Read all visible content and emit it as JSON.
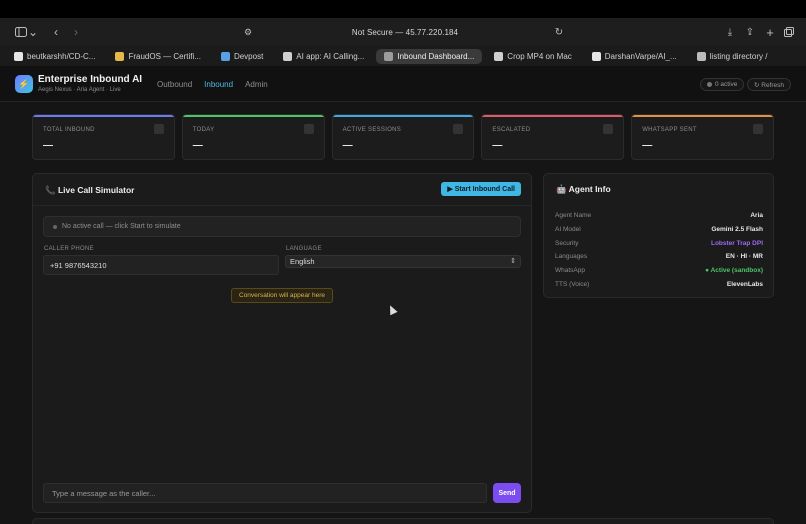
{
  "browser": {
    "address": "Not Secure — 45.77.220.184",
    "tabs": [
      {
        "label": "beutkarshh/CD-C...",
        "color": "#e5e5e5"
      },
      {
        "label": "FraudOS — Certifi...",
        "color": "#e6b84a"
      },
      {
        "label": "Devpost",
        "color": "#5aa0e6"
      },
      {
        "label": "AI app: AI Calling...",
        "color": "#cfcfcf"
      },
      {
        "label": "Inbound Dashboard...",
        "color": "#9c9c9c",
        "active": true
      },
      {
        "label": "Crop MP4 on Mac",
        "color": "#cfcfcf"
      },
      {
        "label": "DarshanVarpe/AI_...",
        "color": "#e5e5e5"
      },
      {
        "label": "listing directory /",
        "color": "#bbbbbb"
      }
    ]
  },
  "app": {
    "title": "Enterprise Inbound AI",
    "subtitle": "Aegis Nexus · Aria Agent · Live",
    "nav": [
      "Outbound",
      "Inbound",
      "Admin"
    ],
    "active_nav": "Inbound",
    "active_pill": "0 active",
    "refresh_label": "↻ Refresh"
  },
  "stats": [
    {
      "label": "TOTAL INBOUND",
      "value": "—",
      "color": "#6b7cf0",
      "icon": "phone-icon"
    },
    {
      "label": "TODAY",
      "value": "—",
      "color": "#4cc46a",
      "icon": "calendar-icon"
    },
    {
      "label": "ACTIVE SESSIONS",
      "value": "—",
      "color": "#3fa8e0",
      "icon": "robot-icon"
    },
    {
      "label": "ESCALATED",
      "value": "—",
      "color": "#e05a6a",
      "icon": "alert-icon"
    },
    {
      "label": "WHATSAPP SENT",
      "value": "—",
      "color": "#e0904a",
      "icon": "chat-icon"
    }
  ],
  "simulator": {
    "title": "📞 Live Call Simulator",
    "start_label": "▶ Start Inbound Call",
    "status": "No active call — click Start to simulate",
    "caller_phone_label": "CALLER PHONE",
    "caller_phone_value": "+91 9876543210",
    "language_label": "LANGUAGE",
    "language_value": "English",
    "conversation_hint": "Conversation will appear here",
    "message_placeholder": "Type a message as the caller...",
    "send_label": "Send"
  },
  "agent": {
    "title": "🤖 Agent Info",
    "rows": [
      {
        "k": "Agent Name",
        "v": "Aria",
        "color": "#e8e8e8"
      },
      {
        "k": "AI Model",
        "v": "Gemini 2.5 Flash",
        "color": "#e8e8e8"
      },
      {
        "k": "Security",
        "v": "Lobster Trap DPI",
        "color": "#9b6bf2"
      },
      {
        "k": "Languages",
        "v": "EN · HI · MR",
        "color": "#e8e8e8"
      },
      {
        "k": "WhatsApp",
        "v": "● Active (sandbox)",
        "color": "#4cc46a"
      },
      {
        "k": "TTS (Voice)",
        "v": "ElevenLabs",
        "color": "#e8e8e8"
      }
    ]
  }
}
